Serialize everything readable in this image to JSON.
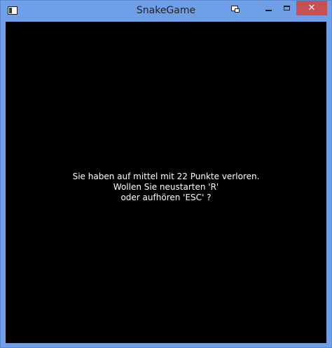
{
  "window": {
    "title": "SnakeGame",
    "buttons": {
      "minimize": "minimize",
      "maximize": "maximize",
      "close": "✕"
    },
    "icons": [
      "app-icon",
      "restore-extra-icon",
      "minimize-icon",
      "maximize-icon",
      "close-icon"
    ],
    "colors": {
      "titlebar": "#6f9fe6",
      "close": "#c75050",
      "client": "#000000",
      "text": "#ffffff"
    }
  },
  "game": {
    "message_lines": [
      "Sie haben auf mittel mit 22 Punkte verloren.",
      "Wollen Sie neustarten 'R'",
      "oder aufhören 'ESC' ?"
    ]
  }
}
